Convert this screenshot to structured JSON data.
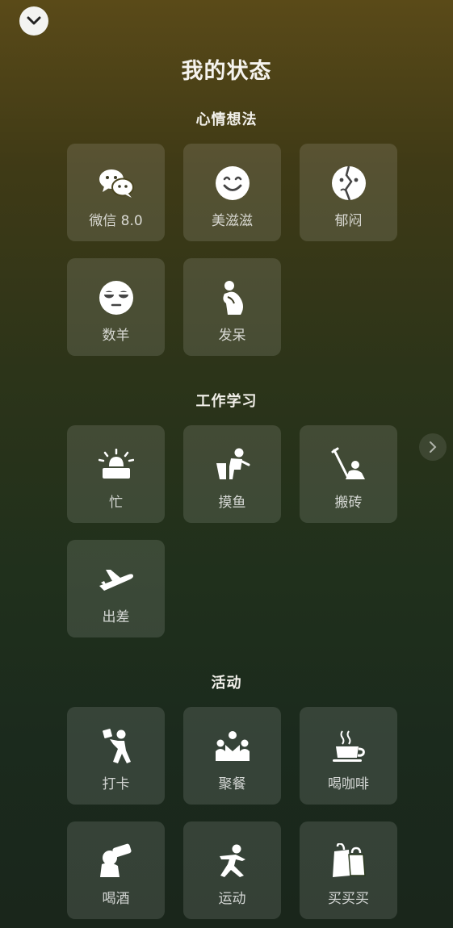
{
  "header": {
    "title": "我的状态",
    "collapse_icon": "chevron-down-icon"
  },
  "sections": [
    {
      "title": "心情想法",
      "items": [
        {
          "label": "微信 8.0",
          "icon": "wechat-icon"
        },
        {
          "label": "美滋滋",
          "icon": "smile-face-icon"
        },
        {
          "label": "郁闷",
          "icon": "gloomy-face-icon"
        },
        {
          "label": "数羊",
          "icon": "sleepy-face-icon"
        },
        {
          "label": "发呆",
          "icon": "daydream-figure-icon"
        }
      ]
    },
    {
      "title": "工作学习",
      "items": [
        {
          "label": "忙",
          "icon": "alarm-siren-icon"
        },
        {
          "label": "摸鱼",
          "icon": "slacking-figure-icon"
        },
        {
          "label": "搬砖",
          "icon": "brick-worker-icon"
        },
        {
          "label": "出差",
          "icon": "airplane-icon"
        }
      ]
    },
    {
      "title": "活动",
      "items": [
        {
          "label": "打卡",
          "icon": "check-in-figure-icon"
        },
        {
          "label": "聚餐",
          "icon": "group-dinner-icon"
        },
        {
          "label": "喝咖啡",
          "icon": "coffee-cup-icon"
        },
        {
          "label": "喝酒",
          "icon": "drinking-icon"
        },
        {
          "label": "运动",
          "icon": "running-figure-icon"
        },
        {
          "label": "买买买",
          "icon": "shopping-bags-icon"
        }
      ]
    }
  ],
  "side_nav": {
    "icon": "chevron-right-icon"
  }
}
